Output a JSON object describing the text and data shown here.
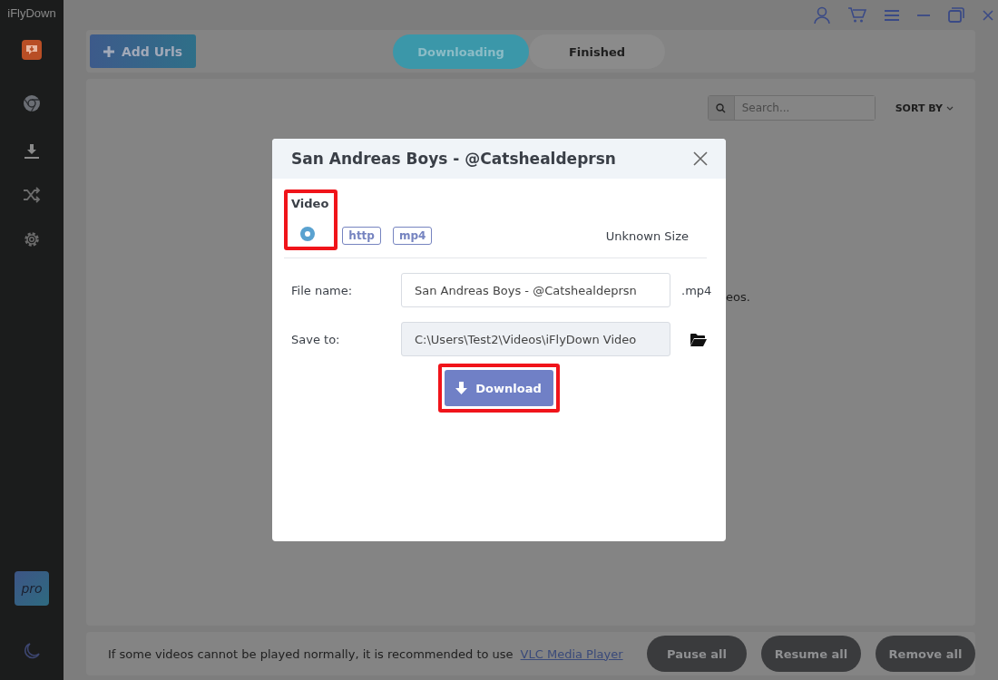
{
  "app": {
    "title": "iFlyDown"
  },
  "sidebar": {
    "pro_badge": "pro"
  },
  "toolbar": {
    "add_button": "Add Urls",
    "tabs": [
      {
        "label": "Downloading",
        "selected": true
      },
      {
        "label": "Finished",
        "selected": false
      }
    ]
  },
  "search": {
    "placeholder": "Search..."
  },
  "sort": {
    "label": "SORT BY"
  },
  "background_message": "eos.",
  "dialog": {
    "title": "San Andreas Boys - @Catshealdeprsn",
    "section": "Video",
    "options": [
      {
        "selected": true,
        "tags": [
          "http",
          "mp4"
        ],
        "size": "Unknown Size",
        "highlighted": true
      }
    ],
    "file_name": {
      "label": "File name:",
      "value": "San Andreas Boys - @Catshealdeprsn",
      "extension": ".mp4"
    },
    "save_to": {
      "label": "Save to:",
      "value": "C:\\Users\\Test2\\Videos\\iFlyDown Video"
    },
    "download": {
      "label": "Download",
      "highlighted": true
    }
  },
  "footer": {
    "notice": "If some videos cannot be played normally, it is recommended to use",
    "link": "VLC Media Player",
    "buttons": [
      "Pause all",
      "Resume all",
      "Remove all"
    ]
  }
}
